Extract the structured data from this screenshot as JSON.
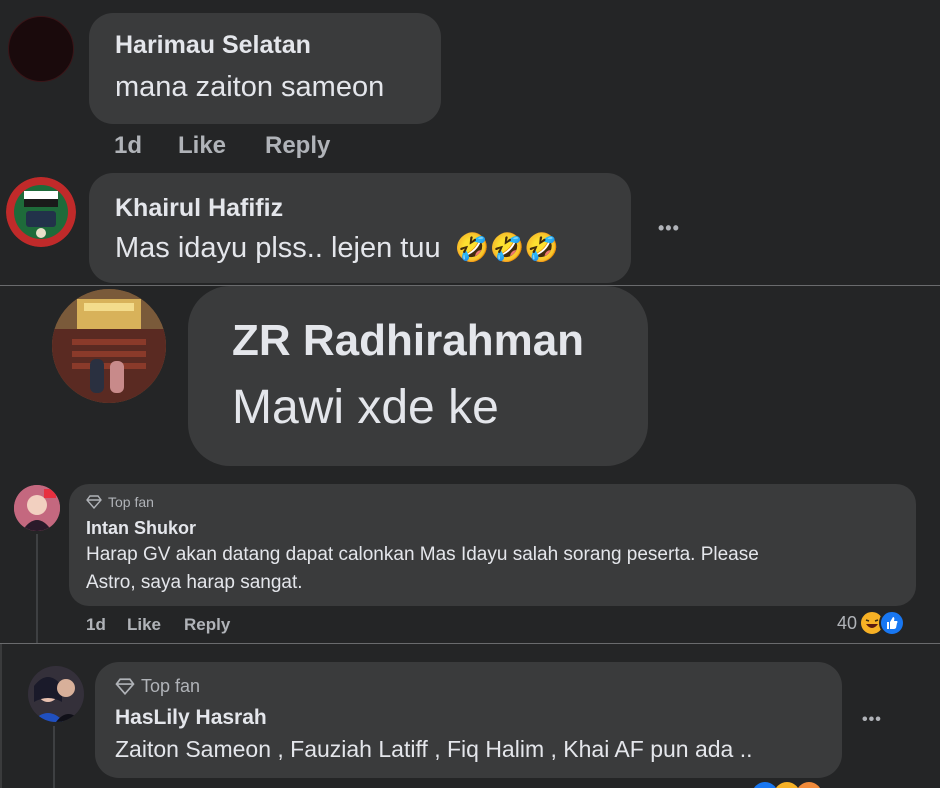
{
  "comments": [
    {
      "name": "Harimau Selatan",
      "text": "mana zaiton sameon",
      "time": "1d",
      "like": "Like",
      "reply": "Reply"
    },
    {
      "name": "Khairul Hafifiz",
      "text": "Mas idayu plss.. lejen tuu",
      "emoji": "🤣🤣🤣",
      "more": "•••"
    },
    {
      "name": "ZR Radhirahman",
      "text": "Mawi xde ke"
    },
    {
      "badge": "Top fan",
      "name": "Intan Shukor",
      "text_line1": "Harap GV akan datang dapat calonkan Mas Idayu salah sorang peserta. Please",
      "text_line2": "Astro, saya harap sangat.",
      "time": "1d",
      "like": "Like",
      "reply": "Reply",
      "reaction_count": "40"
    },
    {
      "badge": "Top fan",
      "name": "HasLily Hasrah",
      "text": "Zaiton Sameon , Fauziah Latiff , Fiq Halim , Khai AF pun ada ..",
      "more": "•••"
    }
  ],
  "colors": {
    "background": "#242526",
    "bubble": "#3a3b3c",
    "text": "#e4e6eb",
    "secondary": "#b0b3b8",
    "like_blue": "#1877f2"
  }
}
